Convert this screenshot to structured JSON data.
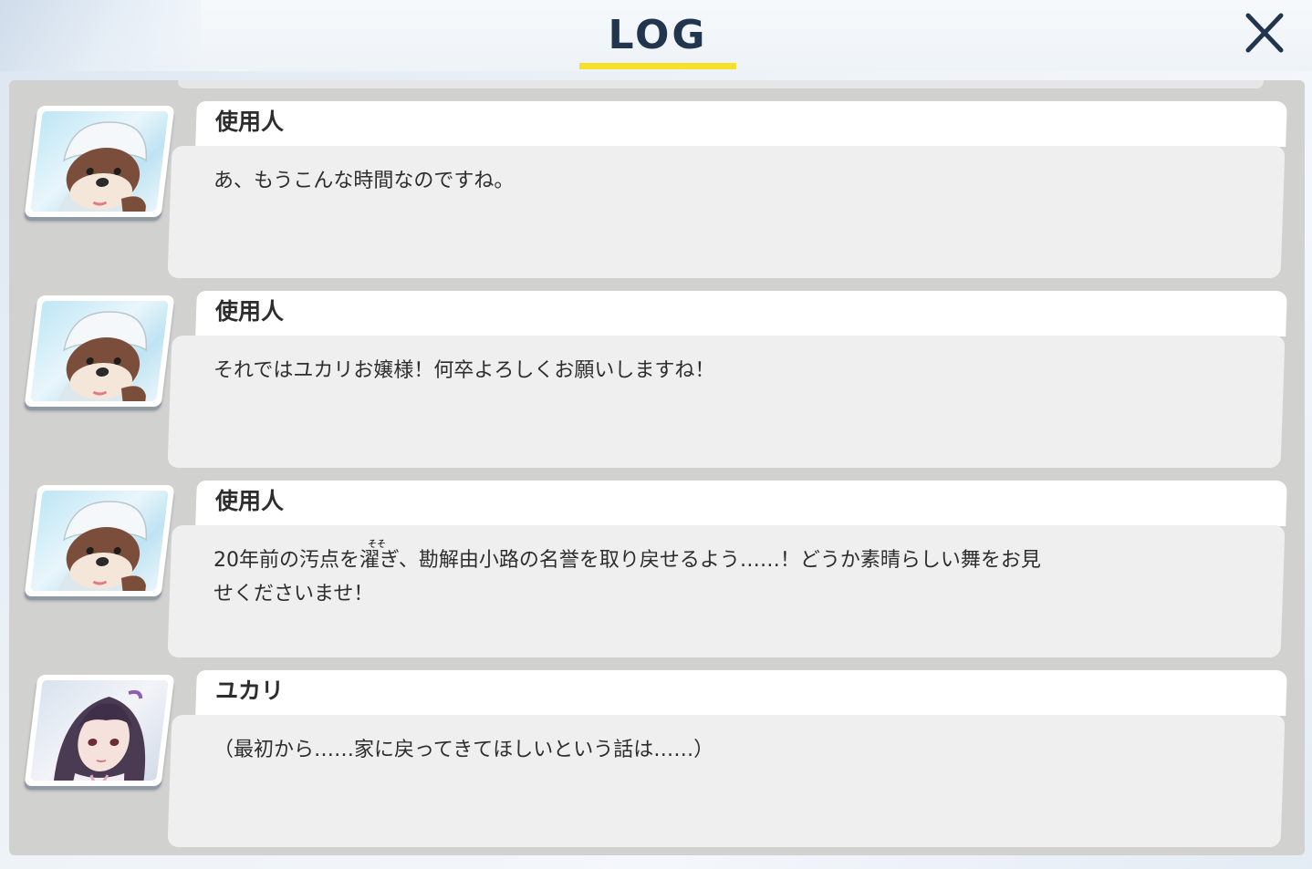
{
  "header": {
    "title": "LOG"
  },
  "log": [
    {
      "speaker": "使用人",
      "avatar": "servant",
      "text": "あ、もうこんな時間なのですね。"
    },
    {
      "speaker": "使用人",
      "avatar": "servant",
      "text": "それではユカリお嬢様！何卒よろしくお願いしますね！"
    },
    {
      "speaker": "使用人",
      "avatar": "servant",
      "text_line1": "20年前の汚点を濯ぎ、勘解由小路の名誉を取り戻せるよう……！どうか素晴らしい舞をお見",
      "text_line2": "せくださいませ！",
      "ruby": "そそ"
    },
    {
      "speaker": "ユカリ",
      "avatar": "yukari",
      "text": "（最初から……家に戻ってきてほしいという話は……）"
    }
  ],
  "colors": {
    "accent": "#f5e12a",
    "title": "#22354f",
    "panel": "#d1d1d0"
  }
}
